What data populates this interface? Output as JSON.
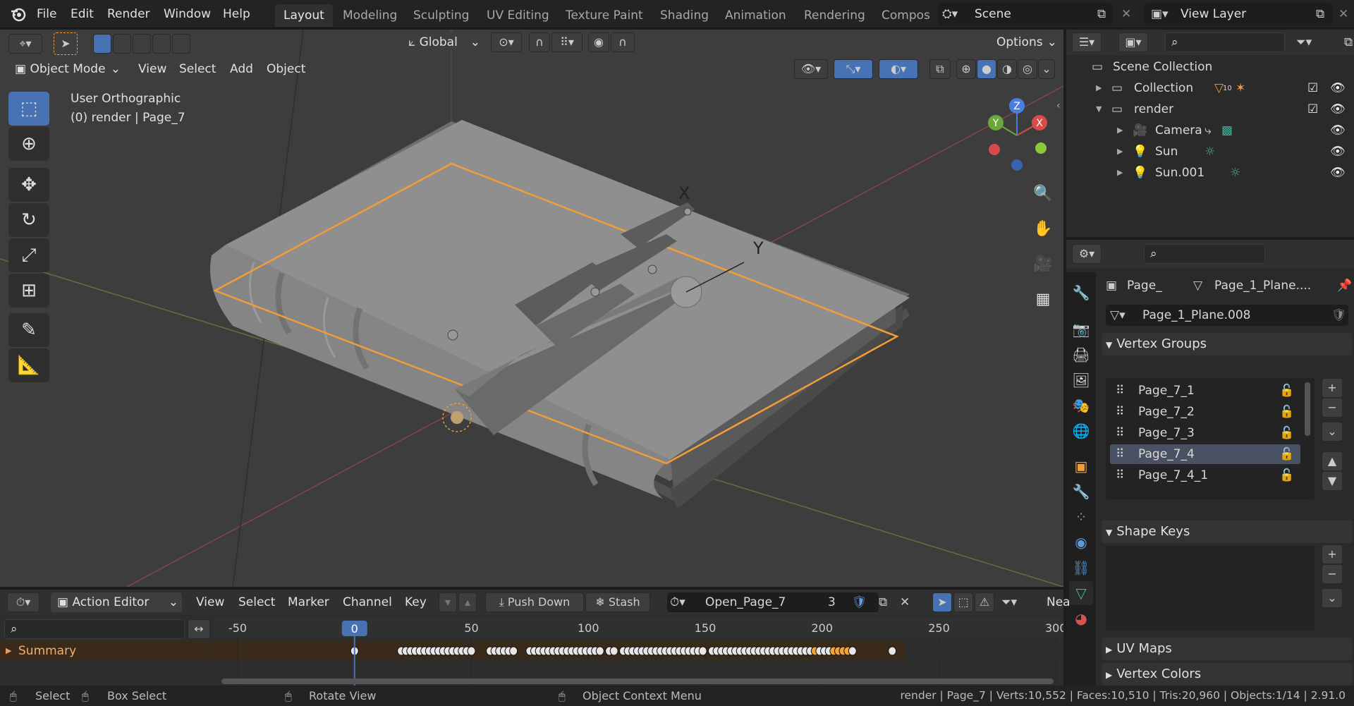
{
  "menu": [
    "File",
    "Edit",
    "Render",
    "Window",
    "Help"
  ],
  "workspaces": [
    {
      "label": "Layout",
      "active": true
    },
    {
      "label": "Modeling",
      "active": false
    },
    {
      "label": "Sculpting",
      "active": false
    },
    {
      "label": "UV Editing",
      "active": false
    },
    {
      "label": "Texture Paint",
      "active": false
    },
    {
      "label": "Shading",
      "active": false
    },
    {
      "label": "Animation",
      "active": false
    },
    {
      "label": "Rendering",
      "active": false
    },
    {
      "label": "Compos",
      "active": false
    }
  ],
  "scene": {
    "name": "Scene",
    "view_layer": "View Layer"
  },
  "toolbar": {
    "orientation": "Global",
    "options": "Options"
  },
  "viewport": {
    "mode": "Object Mode",
    "menus": [
      "View",
      "Select",
      "Add",
      "Object"
    ],
    "view_name": "User Orthographic",
    "context": "(0) render | Page_7",
    "gizmo": {
      "x": "X",
      "y": "Y",
      "z": "Z"
    },
    "empty_labels": {
      "x": "X",
      "y": "Y"
    }
  },
  "outliner": {
    "search_placeholder": "",
    "root": "Scene Collection",
    "items": [
      {
        "label": "Collection",
        "indent": 1,
        "expanded": false,
        "checked": true,
        "badge": "10"
      },
      {
        "label": "render",
        "indent": 1,
        "expanded": true,
        "checked": true
      },
      {
        "label": "Camera",
        "indent": 2,
        "expanded": false
      },
      {
        "label": "Sun",
        "indent": 2,
        "expanded": false
      },
      {
        "label": "Sun.001",
        "indent": 2,
        "expanded": false
      }
    ]
  },
  "properties": {
    "breadcrumb_object": "Page_",
    "breadcrumb_data": "Page_1_Plane....",
    "mesh_name": "Page_1_Plane.008",
    "vertex_groups_title": "Vertex Groups",
    "vertex_groups": [
      {
        "label": "Page_7_1",
        "selected": false
      },
      {
        "label": "Page_7_2",
        "selected": false
      },
      {
        "label": "Page_7_3",
        "selected": false
      },
      {
        "label": "Page_7_4",
        "selected": true
      },
      {
        "label": "Page_7_4_1",
        "selected": false
      }
    ],
    "shape_keys_title": "Shape Keys",
    "uv_maps_title": "UV Maps",
    "vertex_colors_title": "Vertex Colors"
  },
  "dopesheet": {
    "mode": "Action Editor",
    "menus": [
      "View",
      "Select",
      "Marker",
      "Channel",
      "Key"
    ],
    "push_down": "Push Down",
    "stash": "Stash",
    "action_name": "Open_Page_7",
    "users": "3",
    "nearest": "Nea",
    "summary": "Summary",
    "current_frame": "0",
    "ruler": [
      "-50",
      "0",
      "50",
      "100",
      "150",
      "200",
      "250",
      "300"
    ],
    "keyframes": [
      0,
      20,
      22,
      24,
      26,
      28,
      30,
      32,
      34,
      36,
      38,
      40,
      42,
      44,
      46,
      48,
      50,
      58,
      60,
      62,
      64,
      66,
      68,
      75,
      77,
      79,
      81,
      83,
      85,
      87,
      89,
      91,
      93,
      95,
      97,
      99,
      101,
      103,
      105,
      109,
      111,
      115,
      117,
      119,
      121,
      123,
      125,
      127,
      129,
      131,
      133,
      135,
      137,
      139,
      141,
      143,
      145,
      147,
      149,
      153,
      155,
      157,
      159,
      161,
      163,
      165,
      167,
      169,
      171,
      173,
      175,
      177,
      179,
      181,
      183,
      185,
      187,
      189,
      191,
      193,
      195,
      197,
      199,
      201,
      203,
      205,
      207,
      209,
      211,
      213,
      230
    ],
    "selected_keyframes": [
      197,
      205,
      207,
      209,
      211
    ]
  },
  "statusbar": {
    "select": "Select",
    "box_select": "Box Select",
    "rotate_view": "Rotate View",
    "context_menu": "Object Context Menu",
    "stats": "render | Page_7 | Verts:10,552 | Faces:10,510 | Tris:20,960 | Objects:1/14 | 2.91.0"
  },
  "colors": {
    "accent": "#4772b3",
    "selection": "#f29d38",
    "background": "#3d3d3d"
  }
}
